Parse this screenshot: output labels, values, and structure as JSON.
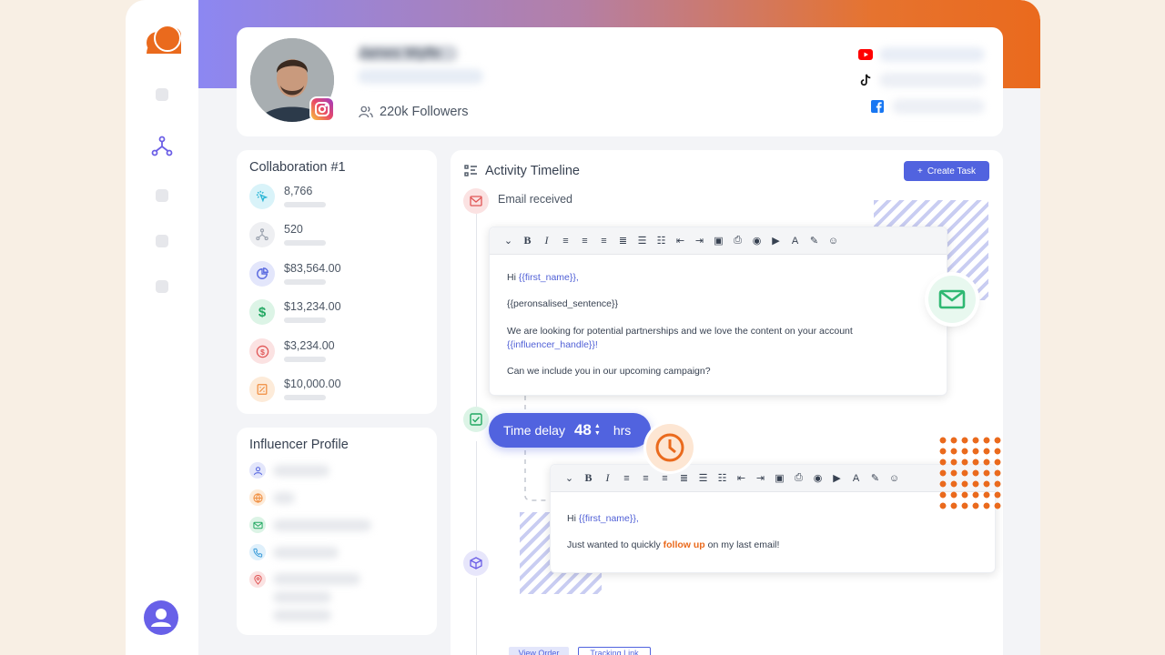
{
  "profile": {
    "name": "James Wylfe",
    "subtitle": "",
    "followers": "220k Followers",
    "socials": [
      "youtube-icon",
      "tiktok-icon",
      "facebook-icon"
    ]
  },
  "collaboration": {
    "title": "Collaboration #1",
    "stats": [
      {
        "icon": "click-icon",
        "value": "8,766",
        "color": "#2bb6d6"
      },
      {
        "icon": "network-icon",
        "value": "520",
        "color": "#9ca3af"
      },
      {
        "icon": "pie-chart-icon",
        "value": "$83,564.00",
        "color": "#5b6be0"
      },
      {
        "icon": "dollar-icon",
        "value": "$13,234.00",
        "color": "#22a862"
      },
      {
        "icon": "dollar-circle-icon",
        "value": "$3,234.00",
        "color": "#e05656"
      },
      {
        "icon": "receipt-icon",
        "value": "$10,000.00",
        "color": "#f08c3c"
      }
    ]
  },
  "influencer_profile": {
    "title": "Influencer Profile",
    "rows": [
      "user-icon",
      "globe-icon",
      "mail-icon",
      "phone-icon",
      "location-icon"
    ]
  },
  "timeline": {
    "title": "Activity Timeline",
    "create_label": "Create Task",
    "event1": "Email received",
    "email1": {
      "greeting_prefix": "Hi ",
      "greeting_var": "{{first_name}},",
      "sentence_var": "{{peronsalised_sentence}}",
      "body": "We are looking for potential partnerships and we love the content on your account",
      "handle_var": "{{influencer_handle}}!",
      "closing": "Can we include you in our upcoming campaign?"
    },
    "delay": {
      "label": "Time delay",
      "value": "48",
      "unit": "hrs"
    },
    "email2": {
      "greeting_prefix": "Hi ",
      "greeting_var": "{{first_name}},",
      "line_prefix": "Just wanted to quickly ",
      "line_highlight": "follow up",
      "line_suffix": " on my last email!"
    },
    "view_order": "View Order",
    "tracking_link": "Tracking Link"
  }
}
